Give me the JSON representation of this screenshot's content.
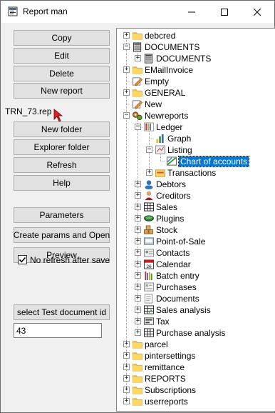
{
  "window": {
    "title": "Report man"
  },
  "buttons": {
    "copy": "Copy",
    "edit": "Edit",
    "delete": "Delete",
    "new_report": "New report",
    "new_folder": "New folder",
    "explorer_folder": "Explorer folder",
    "refresh": "Refresh",
    "help": "Help",
    "parameters": "Parameters",
    "create_params_open": "Create params and Open",
    "preview": "Preview",
    "select_test_doc": "select Test document id"
  },
  "current_file": "TRN_73.rep",
  "no_refresh": {
    "label": "No refresh after save",
    "checked": true
  },
  "doc_id": {
    "value": "43"
  },
  "tree": {
    "items": [
      {
        "label": "debcred",
        "icon": "folder-icon"
      },
      {
        "label": "DOCUMENTS",
        "icon": "document-stack-icon"
      },
      {
        "label": "DOCUMENTS",
        "icon": "document-stack-icon"
      },
      {
        "label": "EMailInvoice",
        "icon": "folder-icon"
      },
      {
        "label": "Empty",
        "icon": "edit-pencil-icon"
      },
      {
        "label": "GENERAL",
        "icon": "folder-icon"
      },
      {
        "label": "New",
        "icon": "edit-pencil-icon"
      },
      {
        "label": "Newreports",
        "icon": "gears-icon"
      },
      {
        "label": "Ledger",
        "icon": "ledger-icon"
      },
      {
        "label": "Graph",
        "icon": "bar-graph-icon"
      },
      {
        "label": "Listing",
        "icon": "listing-icon"
      },
      {
        "label": "Chart of accounts",
        "icon": "chart-of-accounts-icon",
        "selected": true
      },
      {
        "label": "Transactions",
        "icon": "transactions-icon"
      },
      {
        "label": "Debtors",
        "icon": "debtors-icon"
      },
      {
        "label": "Creditors",
        "icon": "creditors-icon"
      },
      {
        "label": "Sales",
        "icon": "sales-icon"
      },
      {
        "label": "Plugins",
        "icon": "plugins-icon"
      },
      {
        "label": "Stock",
        "icon": "stock-icon"
      },
      {
        "label": "Point-of-Sale",
        "icon": "pos-icon"
      },
      {
        "label": "Contacts",
        "icon": "contacts-icon"
      },
      {
        "label": "Calendar",
        "icon": "calendar-icon"
      },
      {
        "label": "Batch entry",
        "icon": "batch-entry-icon"
      },
      {
        "label": "Purchases",
        "icon": "purchases-icon"
      },
      {
        "label": "Documents",
        "icon": "documents-icon"
      },
      {
        "label": "Sales analysis",
        "icon": "sales-analysis-icon"
      },
      {
        "label": "Tax",
        "icon": "tax-icon"
      },
      {
        "label": "Purchase analysis",
        "icon": "purchase-analysis-icon"
      },
      {
        "label": "parcel",
        "icon": "folder-icon"
      },
      {
        "label": "pintersettings",
        "icon": "folder-icon"
      },
      {
        "label": "remittance",
        "icon": "folder-icon"
      },
      {
        "label": "REPORTS",
        "icon": "folder-icon"
      },
      {
        "label": "Subscriptions",
        "icon": "folder-icon"
      },
      {
        "label": "userreports",
        "icon": "folder-icon"
      }
    ]
  },
  "colors": {
    "selection": "#0078d7",
    "folder": "#f4c64b"
  }
}
